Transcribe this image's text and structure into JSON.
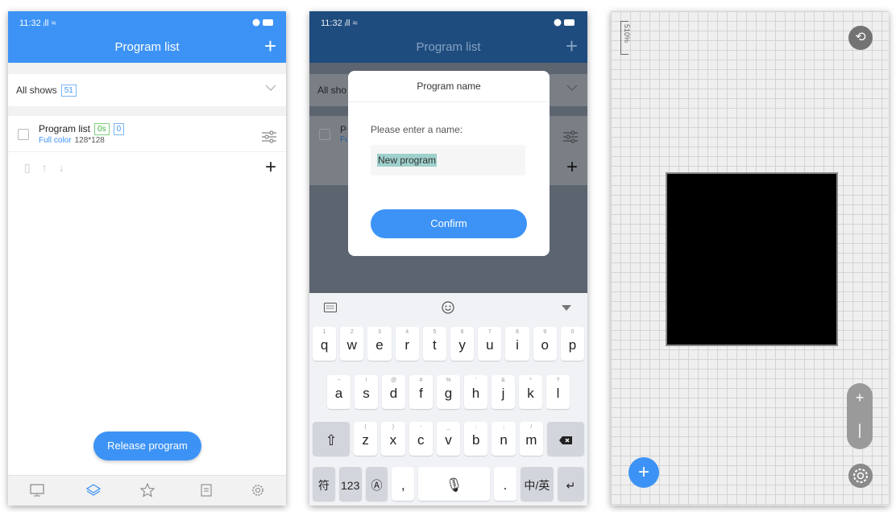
{
  "screen1": {
    "status_time": "11:32",
    "status_signal": "ᵢll",
    "title": "Program list",
    "add_icon": "plus-icon",
    "all_shows_label": "All shows",
    "all_shows_count": "51",
    "program": {
      "name": "Program list",
      "duration": "0s",
      "count": "0",
      "color_mode": "Full color",
      "resolution": "128*128"
    },
    "release_label": "Release program",
    "tabs": [
      "screen-icon",
      "layers-icon",
      "star-icon",
      "list-icon",
      "gear-icon"
    ],
    "accent": "#3d93f5"
  },
  "screen2": {
    "status_time": "11:32",
    "status_signal": "ᵢll",
    "title": "Program list",
    "all_shows_label": "All sho",
    "program_char": "P",
    "program_sub": "Fu",
    "dialog": {
      "title": "Program name",
      "prompt": "Please enter a name:",
      "value": "New program",
      "confirm_label": "Confirm"
    },
    "keyboard": {
      "row1": [
        "q",
        "w",
        "e",
        "r",
        "t",
        "y",
        "u",
        "i",
        "o",
        "p"
      ],
      "row1_hints": [
        "1",
        "2",
        "3",
        "4",
        "5",
        "6",
        "7",
        "8",
        "9",
        "0"
      ],
      "row2": [
        "a",
        "s",
        "d",
        "f",
        "g",
        "h",
        "j",
        "k",
        "l"
      ],
      "row2_hints": [
        "~",
        "!",
        "@",
        "#",
        "%",
        "'",
        "&",
        "*",
        "?"
      ],
      "row3": [
        "z",
        "x",
        "c",
        "v",
        "b",
        "n",
        "m"
      ],
      "row3_hints": [
        "(",
        ")",
        "-",
        "_",
        ":",
        ";",
        "/"
      ],
      "sym": "符",
      "num": "123",
      "comma": ",",
      "period": ".",
      "lang": "中/英"
    }
  },
  "screen3": {
    "zoom_label": "510%",
    "plus": "+",
    "minus": "|",
    "add": "+"
  }
}
